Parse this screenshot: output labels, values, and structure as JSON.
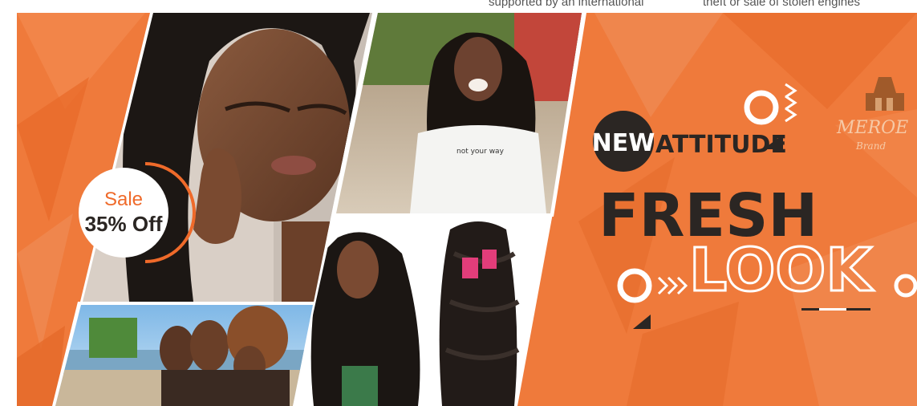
{
  "page": {
    "clipped_text_left": "supported by an international",
    "clipped_text_right": "theft or sale of stolen engines"
  },
  "banner": {
    "sale_label": "Sale",
    "sale_value": "35% Off",
    "tag_new": "NEW",
    "tag_attitude": "ATTITUDE",
    "headline_fresh": "FRESH",
    "headline_look": "LOOK",
    "brand_name": "MEROE",
    "brand_sub": "Brand",
    "shirt_text": "not your way"
  },
  "colors": {
    "brand_orange": "#ef7a3b",
    "dark": "#2b2623",
    "white": "#ffffff"
  }
}
